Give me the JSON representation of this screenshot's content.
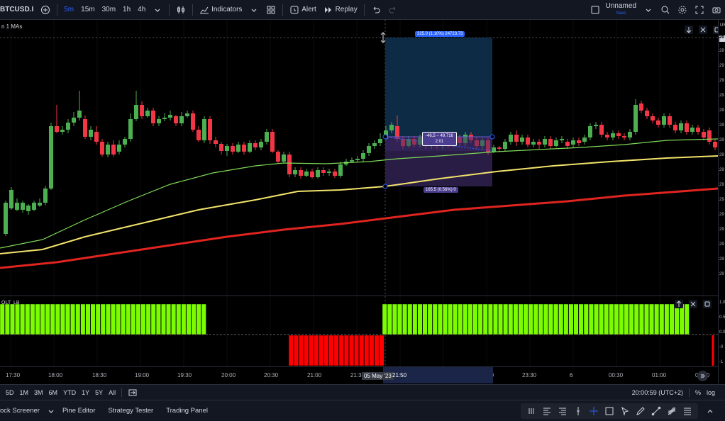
{
  "toolbar": {
    "symbol": "BTCUSD.I",
    "intervals": [
      "5m",
      "15m",
      "30m",
      "1h",
      "4h"
    ],
    "active_interval": "5m",
    "indicators_label": "Indicators",
    "alert_label": "Alert",
    "replay_label": "Replay",
    "layout_name": "Unnamed",
    "layout_status": "Save"
  },
  "chart": {
    "legend_main": "n 1 MAs",
    "legend_osc": "OLT_LB",
    "price_scale_currency": "US",
    "measure_top": "325.0 (1.10%) 24723.73",
    "measure_mid_1": "-46.5 − 49.716",
    "measure_mid_2": "2.01",
    "measure_bottom": "165.5 (0.56%) 0",
    "price_labels": [
      "29",
      "29",
      "29",
      "29",
      "29",
      "29",
      "29",
      "29",
      "29",
      "29",
      "29",
      "29",
      "29",
      "29",
      "29",
      "29",
      "29"
    ],
    "osc_labels": [
      "1.0",
      "0.5",
      "0.0",
      "-0",
      "-1"
    ],
    "time_labels": [
      "17:30",
      "18:00",
      "18:30",
      "19:00",
      "19:30",
      "20:00",
      "20:30",
      "21:00",
      "21:30",
      "22:30",
      "23:00",
      "23:30",
      "6",
      "00:30",
      "01:00",
      "01:30"
    ],
    "crosshair_date": "05 May '23",
    "crosshair_time": "21:50",
    "colors": {
      "up": "#4caf50",
      "down": "#f23645",
      "ma_fast": "#7ed957",
      "ma_mid": "#f2e36b",
      "ma_slow": "#e0241f",
      "osc_up": "#7cfc00",
      "osc_down": "#ff0000"
    }
  },
  "range_bar": {
    "ranges": [
      "5D",
      "1M",
      "3M",
      "6M",
      "YTD",
      "1Y",
      "5Y",
      "All"
    ],
    "clock": "20:00:59 (UTC+2)",
    "percent": "%",
    "log": "log"
  },
  "panel_bar": {
    "tabs": [
      "ock Screener",
      "Pine Editor",
      "Strategy Tester",
      "Trading Panel"
    ]
  }
}
